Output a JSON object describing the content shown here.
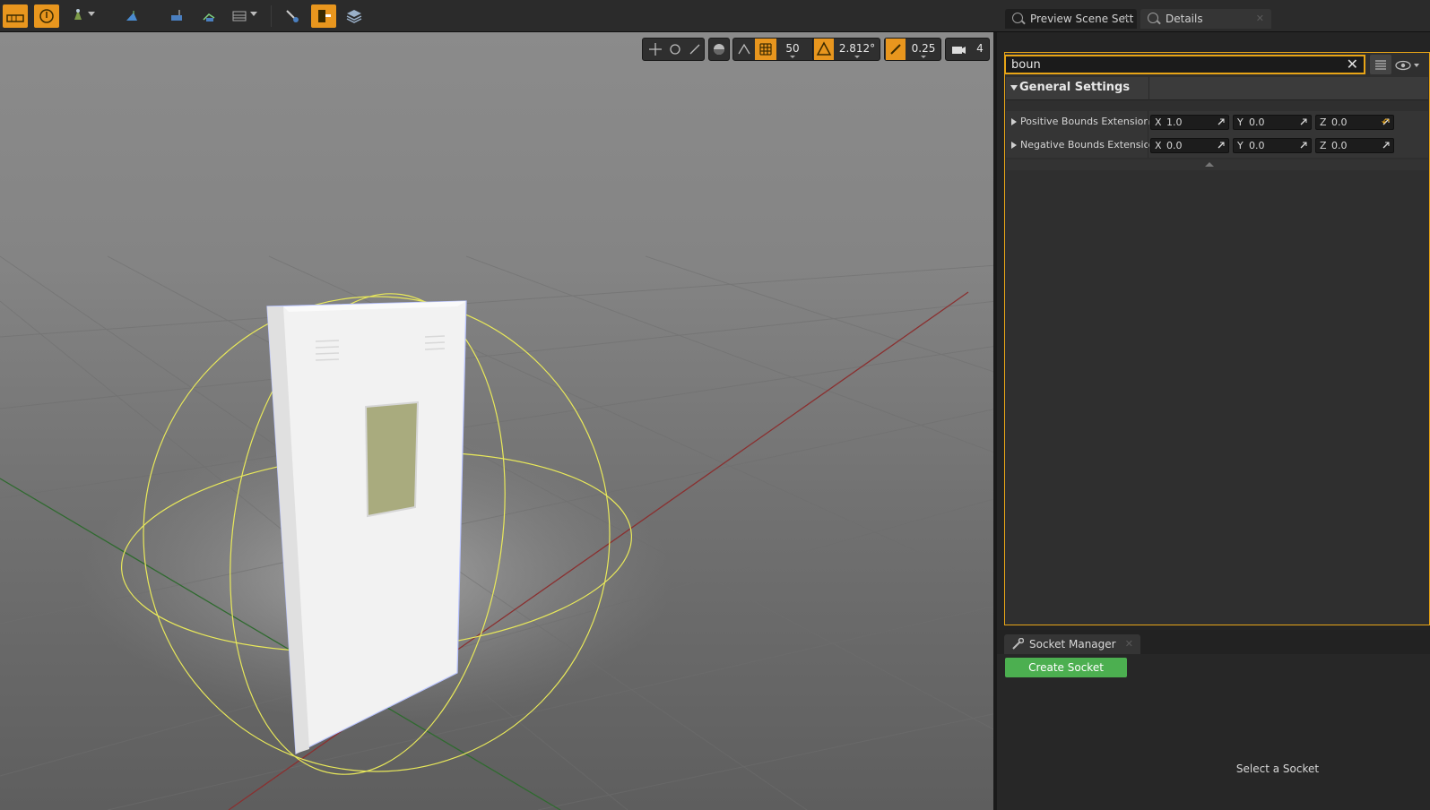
{
  "toolbar": {
    "icons": [
      "floor-grid-icon",
      "realtime-icon",
      "show-toggle-icon",
      "bounds-icon",
      "collision-icon",
      "nav-icon",
      "lod-icon",
      "socket-tool-icon",
      "orange-active-icon",
      "layers-icon"
    ]
  },
  "viewport_toolbar": {
    "grid_snap": "50",
    "rotation_snap": "2.812°",
    "scale_snap": "0.25",
    "camera_speed": "4"
  },
  "tabs": {
    "preview_scene": "Preview Scene Sett",
    "details": "Details"
  },
  "search": {
    "value": "boun"
  },
  "details": {
    "category": "General Settings",
    "rows": [
      {
        "label": "Positive Bounds Extension",
        "x": "1.0",
        "y": "0.0",
        "z": "0.0"
      },
      {
        "label": "Negative Bounds Extension",
        "x": "0.0",
        "y": "0.0",
        "z": "0.0"
      }
    ],
    "axis_labels": {
      "x": "X",
      "y": "Y",
      "z": "Z"
    }
  },
  "socket_manager": {
    "tab_label": "Socket Manager",
    "create_button": "Create Socket",
    "hint": "Select a Socket"
  },
  "colors": {
    "accent": "#e8961e",
    "create_button": "#4caf50",
    "bounds_wire": "#e9e95a"
  }
}
